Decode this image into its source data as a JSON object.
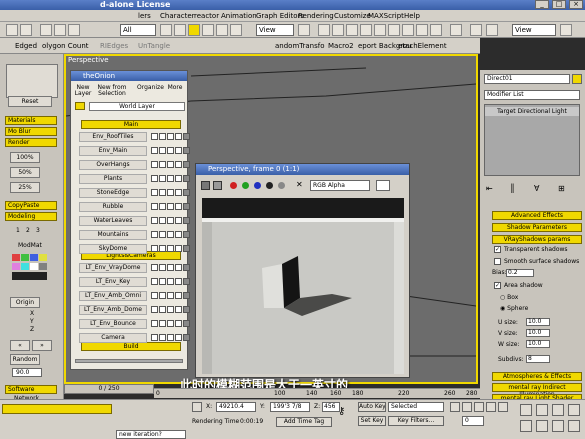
{
  "window": {
    "title": "d-alone License"
  },
  "menus": [
    "lers",
    "Character",
    "reactor",
    "Animation",
    "Graph Editors",
    "Rendering",
    "Customize",
    "MAXScript",
    "Help"
  ],
  "toolbar": {
    "selection_filter": "All",
    "ref_coord": "View",
    "right_dd": "View"
  },
  "toolbar2": {
    "tabs": [
      "Edged",
      "olygon Count",
      "RIEdges",
      "UnTangle",
      "andomTransfo",
      "Macro2",
      "eport Backgrou",
      "etachElement"
    ]
  },
  "left_panel": {
    "reset": "Reset",
    "materials": "Materials",
    "mo_blur": "Mo Blur",
    "render": "Render",
    "pct100": "100%",
    "pct50": "50%",
    "pct25": "25%",
    "copypaste": "CopyPaste",
    "modeling": "Modeling",
    "nums": [
      "1",
      "2",
      "3"
    ],
    "modmat": "ModMat",
    "origin": "Origin",
    "axes": [
      "X",
      "Y",
      "Z"
    ],
    "random": "Random",
    "random_val": "90.0",
    "software": "Software",
    "network": "Network"
  },
  "viewport": {
    "label": "Perspective"
  },
  "onion": {
    "title": "theOnion",
    "new_layer": "New Layer",
    "new_from_selection": "New from Selection",
    "organize": "Organize",
    "more": "More",
    "world_layer": "World Layer",
    "main_header": "Main",
    "layers": [
      "Env_RoofTiles",
      "Env_Main",
      "OverHangs",
      "Plants",
      "StoneEdge",
      "Rubble",
      "WaterLeaves",
      "Mountains",
      "SkyDome"
    ],
    "lights_header": "Lights&Cameras",
    "lights": [
      "LT_Env_VrayDome",
      "LT_Env_Key",
      "LT_Env_Amb_Omni",
      "LT_Env_Amb_Dome",
      "LT_Env_Bounce",
      "Camera"
    ],
    "build": "Build"
  },
  "render_window": {
    "title": "Perspective, frame 0 (1:1)",
    "channel": "RGB Alpha"
  },
  "right_panel": {
    "object_name": "Direct01",
    "modifier_list": "Modifier List",
    "stack_item": "Target Directional Light",
    "advanced_effects": "Advanced Effects",
    "shadow_params": "Shadow Parameters",
    "vray_shadows": "VRayShadows params",
    "transparent_shadows": "Transparent shadows",
    "smooth_surface": "Smooth surface shadows",
    "bias_label": "Bias:",
    "bias_val": "0.2",
    "area_shadow": "Area shadow",
    "box": "Box",
    "sphere": "Sphere",
    "u_size_label": "U size:",
    "u_size": "10.0",
    "v_size_label": "V size:",
    "v_size": "10.0",
    "w_size_label": "W size:",
    "w_size": "10.0",
    "subdivs_label": "Subdivs:",
    "subdivs": "8",
    "atmospheres": "Atmospheres & Effects",
    "mental_indirect": "mental ray Indirect Illumination",
    "mental_light": "mental ray Light Shader"
  },
  "timeline": {
    "frame": "0 / 250",
    "ticks": [
      "0",
      "100",
      "140",
      "160",
      "180",
      "220",
      "260",
      "280"
    ]
  },
  "status": {
    "x_val": "49210.4",
    "y_val": "199'3 7/8",
    "z_val": "456",
    "auto_key": "Auto Key",
    "selected": "Selected",
    "set_key": "Set Key",
    "key_filters": "Key Filters...",
    "rendering_time_label": "Rendering Time",
    "rendering_time": "0:00:19",
    "add_time_tag": "Add Time Tag",
    "prompt": "new iteration?",
    "frame_num": "0"
  },
  "subtitle": "此时的模糊范围是大于一英寸的"
}
